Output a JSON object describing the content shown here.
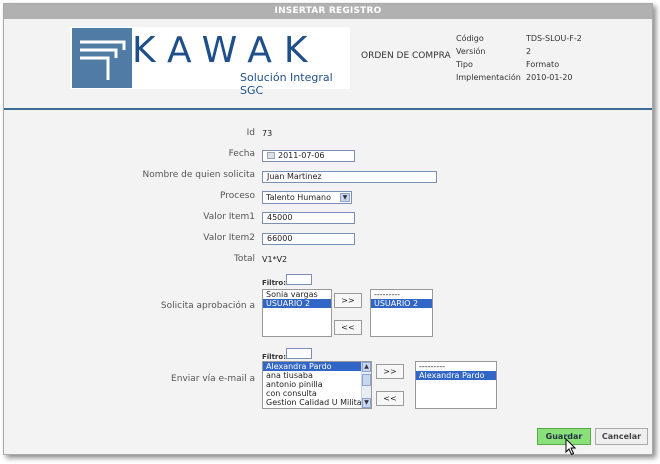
{
  "window": {
    "title": "INSERTAR REGISTRO"
  },
  "header": {
    "logo_text": "KAWAK",
    "logo_sub": "Solución Integral SGC",
    "document_title": "ORDEN DE COMPRA",
    "meta": [
      {
        "key": "Código",
        "value": "TDS-SLOU-F-2"
      },
      {
        "key": "Versión",
        "value": "2"
      },
      {
        "key": "Tipo",
        "value": "Formato"
      },
      {
        "key": "Implementación",
        "value": "2010-01-20"
      }
    ]
  },
  "form": {
    "id": {
      "label": "Id",
      "value": "73"
    },
    "fecha": {
      "label": "Fecha",
      "value": "2011-07-06"
    },
    "solicitante": {
      "label": "Nombre de quien solicita",
      "value": "Juan Martinez"
    },
    "proceso": {
      "label": "Proceso",
      "value": "Talento Humano"
    },
    "item1": {
      "label": "Valor Item1",
      "value": "45000"
    },
    "item2": {
      "label": "Valor Item2",
      "value": "66000"
    },
    "total": {
      "label": "Total",
      "value": "V1*V2"
    },
    "aprobacion": {
      "label": "Solicita aprobación a",
      "filter_label": "Filtro:",
      "available": [
        "Sonia vargas",
        "USUARIO 2"
      ],
      "selected": [
        "---------",
        "USUARIO 2"
      ],
      "add_label": ">>",
      "remove_label": "<<"
    },
    "email": {
      "label": "Enviar vía e-mail a",
      "filter_label": "Filtro:",
      "available": [
        "Alexandra Pardo",
        "ana tiusaba",
        "antonio pinilla",
        "con consulta",
        "Gestion Calidad U Militar"
      ],
      "selected": [
        "---------",
        "Alexandra Pardo"
      ],
      "add_label": ">>",
      "remove_label": "<<"
    }
  },
  "actions": {
    "save": "Guardar",
    "cancel": "Cancelar"
  },
  "colors": {
    "accent": "#3c6b93",
    "save_bg": "#8ae07a",
    "selection": "#3165c6"
  }
}
